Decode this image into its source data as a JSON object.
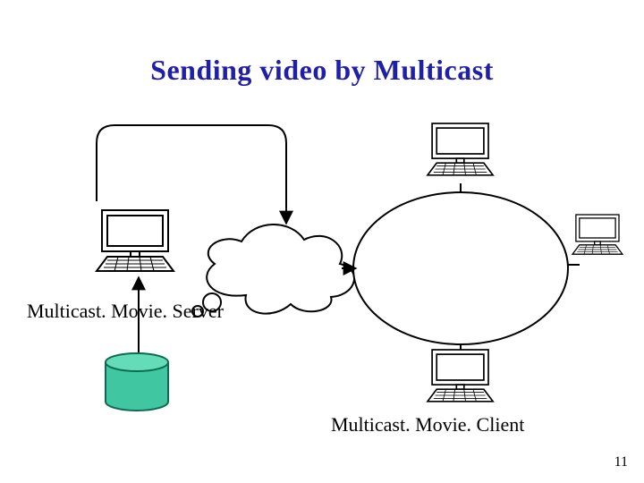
{
  "title": "Sending video by Multicast",
  "labels": {
    "server": "Multicast. Movie. Server",
    "client": "Multicast. Movie. Client"
  },
  "page_number": "11",
  "colors": {
    "title": "#1f1fa8",
    "cylinder_face": "#41c6a2",
    "cylinder_top": "#64dcb8",
    "cylinder_stroke": "#0d6b4f",
    "computer_body": "#ffffff",
    "computer_stroke": "#000000",
    "cloud_fill": "#ffffff",
    "cloud_stroke": "#000000",
    "ellipse_fill": "#ffffff",
    "ellipse_stroke": "#000000",
    "arrow": "#000000"
  },
  "diagram": {
    "type": "network-topology",
    "nodes": [
      {
        "id": "server",
        "kind": "computer",
        "label_key": "labels.server"
      },
      {
        "id": "storage",
        "kind": "cylinder"
      },
      {
        "id": "cloud",
        "kind": "network-cloud"
      },
      {
        "id": "mcast-domain",
        "kind": "ellipse-region"
      },
      {
        "id": "client-top",
        "kind": "computer",
        "label_key": "labels.client"
      },
      {
        "id": "client-right",
        "kind": "computer"
      },
      {
        "id": "client-bottom",
        "kind": "computer"
      }
    ],
    "edges": [
      {
        "from": "storage",
        "to": "server",
        "style": "arrow"
      },
      {
        "from": "server",
        "to": "cloud",
        "style": "arrow"
      },
      {
        "from": "cloud",
        "to": "mcast-domain",
        "style": "arrow"
      },
      {
        "from": "mcast-domain",
        "to": "client-top",
        "style": "line"
      },
      {
        "from": "mcast-domain",
        "to": "client-right",
        "style": "line"
      },
      {
        "from": "mcast-domain",
        "to": "client-bottom",
        "style": "line"
      }
    ]
  }
}
